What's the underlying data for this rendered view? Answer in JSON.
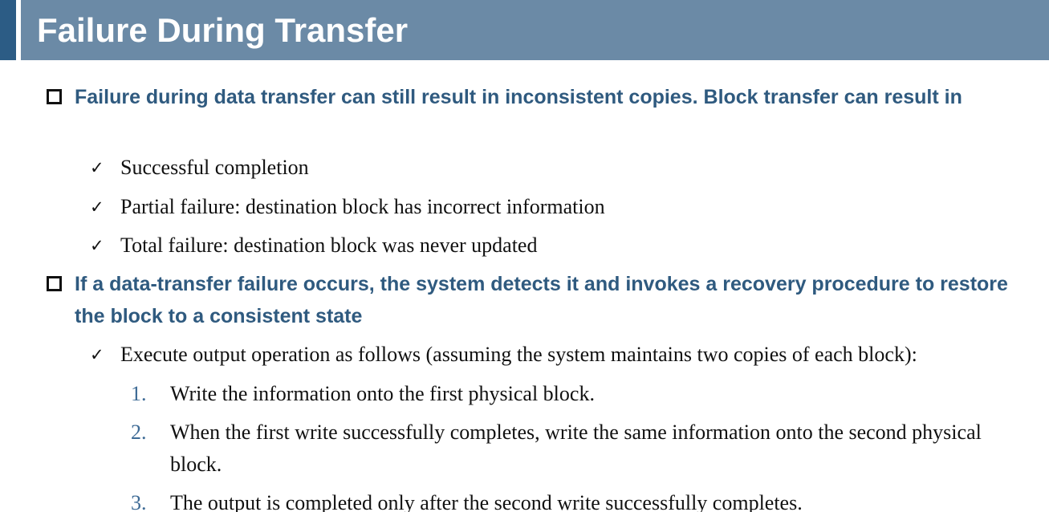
{
  "slide": {
    "title": "Failure During Transfer",
    "bullets": [
      {
        "text": "Failure during data transfer can still result in inconsistent copies. Block transfer can result in",
        "sub": [
          {
            "check": "✓",
            "text": "Successful completion"
          },
          {
            "check": "✓",
            "text": "Partial failure: destination block has incorrect information"
          },
          {
            "check": "✓",
            "text": "Total failure: destination block was never updated"
          }
        ]
      },
      {
        "text": "If a data-transfer failure occurs, the system detects it and invokes a recovery procedure to restore the block to a consistent state",
        "sub": [
          {
            "check": "✓",
            "text": "Execute output operation as follows (assuming the system maintains two copies of each block):",
            "steps": [
              {
                "num": "1.",
                "text": "Write the information onto the first physical block."
              },
              {
                "num": "2.",
                "text": "When the first write successfully completes, write the same information onto the second physical block."
              },
              {
                "num": "3.",
                "text": "The output is completed only after the second write successfully completes."
              }
            ]
          }
        ]
      }
    ]
  },
  "colors": {
    "title_bar": "#6b8aa6",
    "title_accent": "#2c5c85",
    "heading_text": "#2f5a7f",
    "number_text": "#3d6a95"
  }
}
